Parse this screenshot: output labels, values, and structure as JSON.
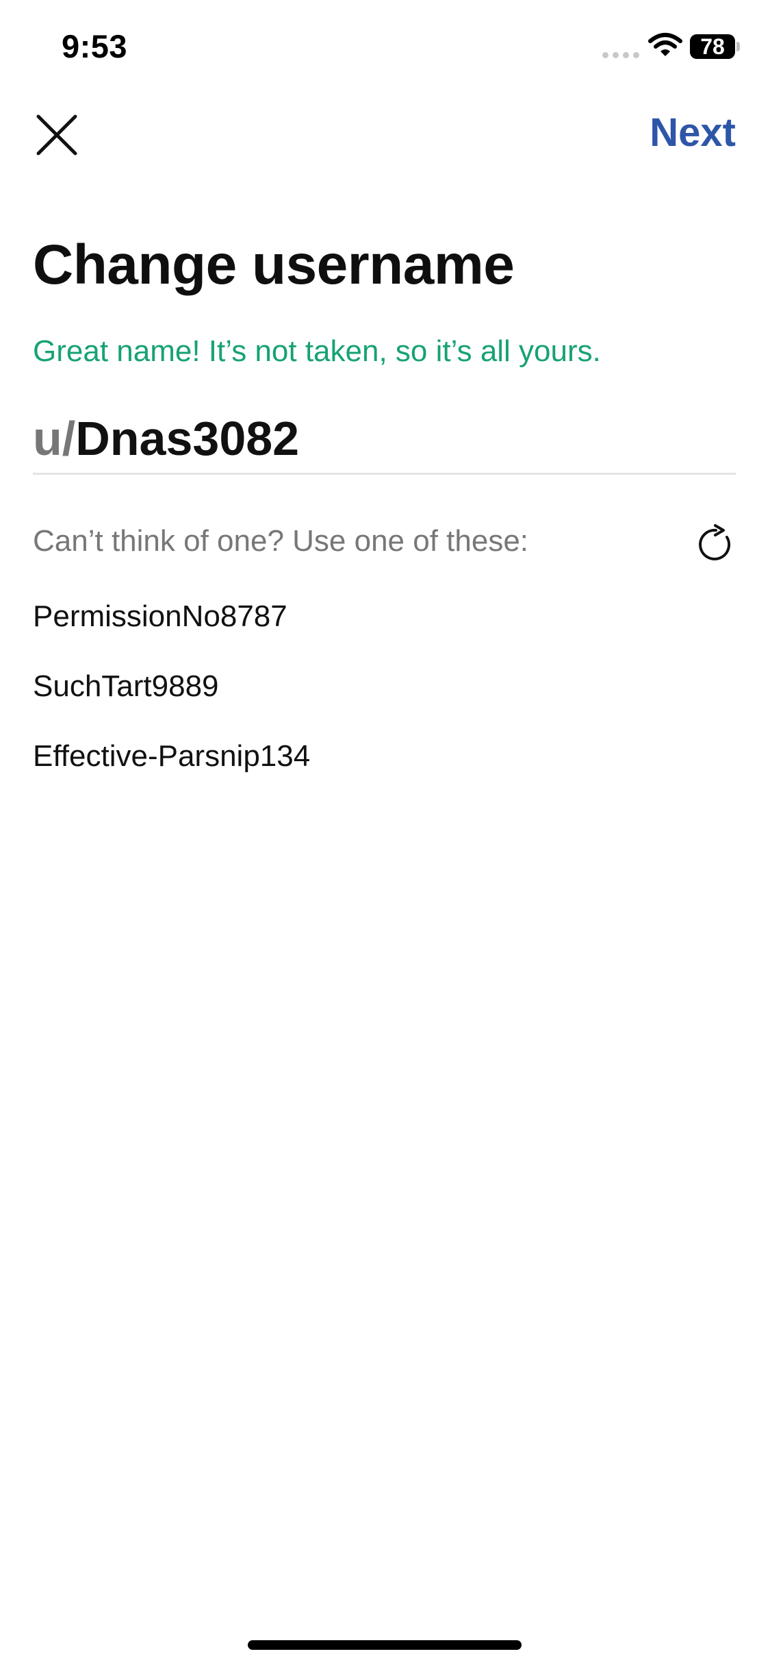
{
  "status_bar": {
    "time": "9:53",
    "battery_level": "78"
  },
  "header": {
    "close_icon": "close-x-icon",
    "next_label": "Next",
    "accent_color": "#2e56a8"
  },
  "title": "Change username",
  "availability_message": "Great name! It’s not taken, so it’s all yours.",
  "availability_color": "#17a273",
  "username": {
    "prefix": "u/",
    "value": "Dnas3082"
  },
  "suggestions": {
    "heading": "Can’t think of one? Use one of these:",
    "refresh_icon": "refresh-icon",
    "items": [
      "PermissionNo8787",
      "SuchTart9889",
      "Effective-Parsnip134"
    ]
  }
}
